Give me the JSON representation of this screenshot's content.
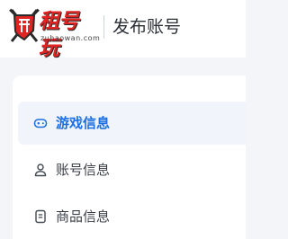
{
  "header": {
    "logo_text": "租号玩",
    "logo_domain": "zuhaowan.com",
    "page_title": "发布账号"
  },
  "sidebar": {
    "items": [
      {
        "label": "游戏信息",
        "icon": "gamepad-icon",
        "active": true
      },
      {
        "label": "账号信息",
        "icon": "user-icon",
        "active": false
      },
      {
        "label": "商品信息",
        "icon": "document-icon",
        "active": false
      }
    ]
  },
  "colors": {
    "accent": "#1d6fe0",
    "logo_red": "#e02424",
    "active_bg": "#f1f5fb",
    "page_bg": "#f4f5f8"
  }
}
